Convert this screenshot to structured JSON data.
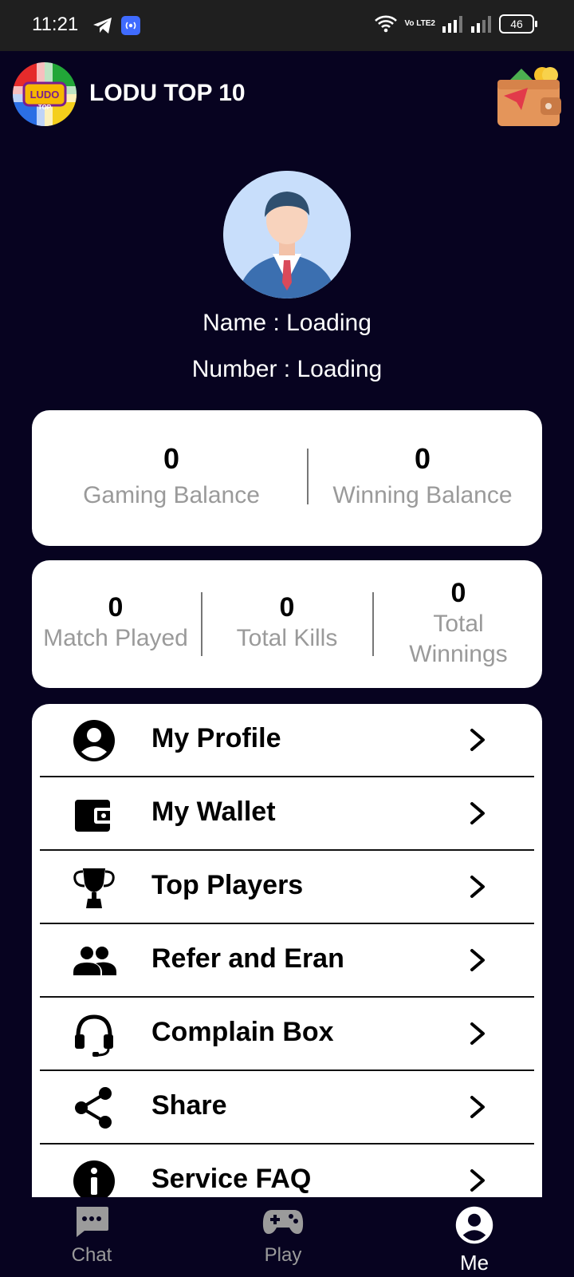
{
  "status_bar": {
    "time": "11:21",
    "network": "Vo LTE2",
    "battery": "46"
  },
  "app": {
    "title": "LODU TOP 10",
    "logo_text": "LUDO TOP"
  },
  "profile": {
    "name_line": "Name : Loading",
    "number_line": "Number : Loading"
  },
  "balances": [
    {
      "value": "0",
      "label": "Gaming Balance"
    },
    {
      "value": "0",
      "label": "Winning Balance"
    }
  ],
  "stats": [
    {
      "value": "0",
      "label": "Match Played"
    },
    {
      "value": "0",
      "label": "Total Kills"
    },
    {
      "value": "0",
      "label_line1": "Total",
      "label_line2": "Winnings"
    }
  ],
  "menu": [
    {
      "label": "My Profile",
      "icon": "account-circle-icon"
    },
    {
      "label": "My Wallet",
      "icon": "wallet-icon"
    },
    {
      "label": "Top Players",
      "icon": "trophy-icon"
    },
    {
      "label": "Refer and Eran",
      "icon": "people-icon"
    },
    {
      "label": "Complain Box",
      "icon": "headset-icon"
    },
    {
      "label": "Share",
      "icon": "share-icon"
    },
    {
      "label": "Service FAQ",
      "icon": "info-icon"
    }
  ],
  "bottom_nav": [
    {
      "label": "Chat",
      "icon": "chat-icon"
    },
    {
      "label": "Play",
      "icon": "gamepad-icon"
    },
    {
      "label": "Me",
      "icon": "account-circle-icon",
      "active": true
    }
  ],
  "colors": {
    "background": "#070320",
    "card": "#ffffff",
    "muted_text": "#9a9a9a"
  }
}
